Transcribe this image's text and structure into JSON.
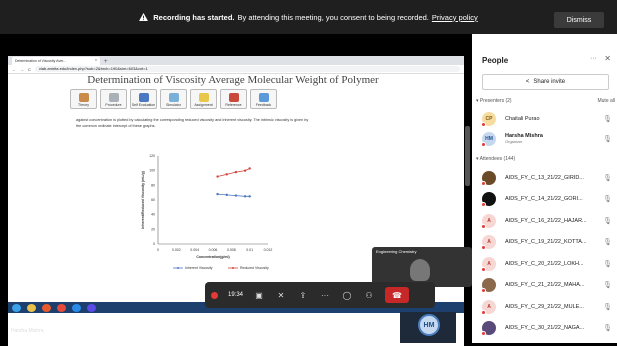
{
  "banner": {
    "bold": "Recording has started.",
    "text": "By attending this meeting, you consent to being recorded.",
    "link": "Privacy policy",
    "dismiss": "Dismiss"
  },
  "browser": {
    "tab_title": "Determination of Viscosity Aver...",
    "tab_close": "×",
    "new_tab": "+",
    "url": "vlab.amrita.edu/index.php?sub=2&brch=190&sim=603&cnt=1"
  },
  "slide": {
    "title": "Determination of Viscosity Average Molecular Weight of Polymer",
    "tabs": [
      "Theory",
      "Procedure",
      "Self Evaluation",
      "Simulator",
      "Assignment",
      "Reference",
      "Feedback"
    ],
    "text1": "against concentration is plotted by calculating the corresponding reduced viscosity and inherent viscosity. The intrinsic viscosity is given by",
    "text2": "the common ordinate intercept of these graphs."
  },
  "chart_data": {
    "type": "line",
    "xlabel": "Concentration(g/ml)",
    "ylabel": "Inherent/Reduced Viscosity (mL/g)",
    "x_ticks": [
      "0",
      "0.002",
      "0.004",
      "0.006",
      "0.008",
      "0.01",
      "0.012"
    ],
    "y_ticks": [
      "0",
      "20",
      "40",
      "60",
      "80",
      "100",
      "120"
    ],
    "xlim": [
      0,
      0.012
    ],
    "ylim": [
      0,
      120
    ],
    "series": [
      {
        "name": "Inherent Viscosity",
        "color": "#4a78c2",
        "x": [
          0.0065,
          0.0075,
          0.0085,
          0.0095,
          0.01
        ],
        "y": [
          68,
          67,
          66,
          65,
          65
        ]
      },
      {
        "name": "Reduced Viscosity",
        "color": "#d0453b",
        "x": [
          0.0065,
          0.0075,
          0.0085,
          0.0095,
          0.01
        ],
        "y": [
          92,
          95,
          98,
          100,
          103
        ]
      }
    ]
  },
  "meeting": {
    "timer": "19:34",
    "tile_label": "Engineering Chemistry",
    "self_initials": "HM",
    "bottom_name": "Harsha Mishra"
  },
  "panel": {
    "title": "People",
    "more": "···",
    "close": "✕",
    "share_invite": "Share invite",
    "presenters_label": "Presenters (2)",
    "mute_all": "Mute all",
    "presenters": [
      {
        "initials": "CP",
        "name": "Chaitali Purao",
        "role": "",
        "bg": "#f7dca0",
        "fg": "#7a5a10"
      },
      {
        "initials": "HM",
        "name": "Harsha Mishra",
        "role": "Organizer",
        "bg": "#c6d8f0",
        "fg": "#1f4e8a"
      }
    ],
    "attendees_label": "Attendees (144)",
    "attendees": [
      {
        "initials": "",
        "name": "AIDS_FY_C_13_21/22_GIRID...",
        "bg": "#6b4a2a",
        "fg": "#fff"
      },
      {
        "initials": "",
        "name": "AIDS_FY_C_14_21/22_GORI...",
        "bg": "#111111",
        "fg": "#fff"
      },
      {
        "initials": "A",
        "name": "AIDS_FY_C_16_21/22_HAJAR...",
        "bg": "#f6d7d3",
        "fg": "#b53a2e"
      },
      {
        "initials": "A",
        "name": "AIDS_FY_C_19_21/22_KOTTA...",
        "bg": "#f6d7d3",
        "fg": "#b53a2e"
      },
      {
        "initials": "A",
        "name": "AIDS_FY_C_20_21/22_LOKH...",
        "bg": "#f6d7d3",
        "fg": "#b53a2e"
      },
      {
        "initials": "",
        "name": "AIDS_FY_C_21_21/22_MAHA...",
        "bg": "#8a6a4a",
        "fg": "#fff"
      },
      {
        "initials": "A",
        "name": "AIDS_FY_C_29_21/22_MULE...",
        "bg": "#f6d7d3",
        "fg": "#b53a2e"
      },
      {
        "initials": "",
        "name": "AIDS_FY_C_30_21/22_NAGA...",
        "bg": "#5a4a7a",
        "fg": "#fff"
      }
    ]
  }
}
